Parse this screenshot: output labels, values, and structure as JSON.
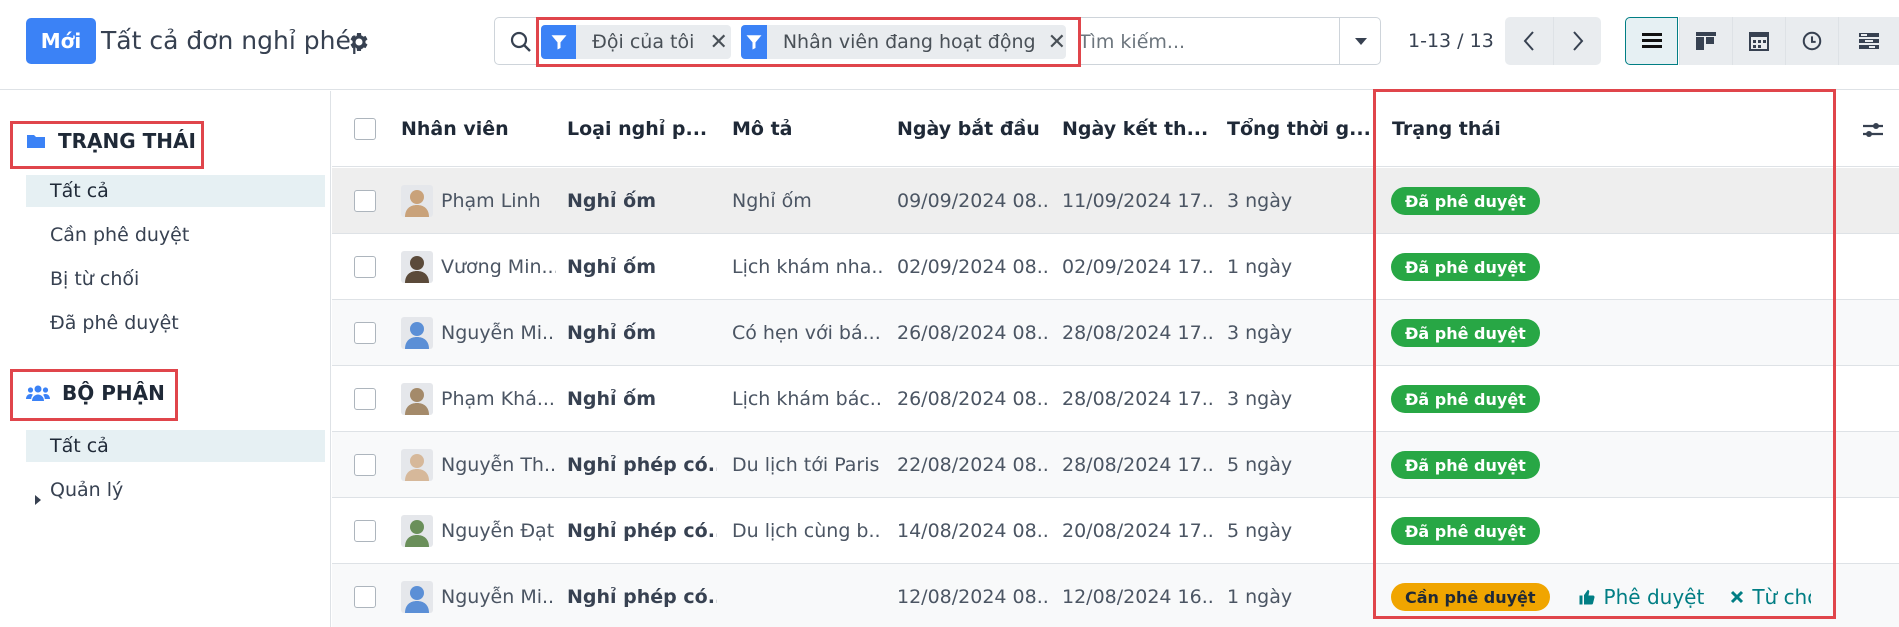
{
  "colors": {
    "primary": "#3b82f6",
    "accent_teal": "#017e84",
    "approved": "#28a745",
    "pending": "#f0a500",
    "highlight_box": "#e0454b"
  },
  "control_panel": {
    "new_button_label": "Mới",
    "title": "Tất cả đơn nghỉ phép",
    "settings_icon": "gear-icon",
    "search": {
      "facets": [
        {
          "label": "Đội của tôi",
          "icon": "filter-icon"
        },
        {
          "label": "Nhân viên đang hoạt động",
          "icon": "filter-icon"
        }
      ],
      "placeholder": "Tìm kiếm..."
    },
    "pager": {
      "value": "1-13 / 13"
    },
    "views": [
      "list-view-icon",
      "kanban-view-icon",
      "calendar-view-icon",
      "activity-view-icon",
      "gantt-view-icon"
    ],
    "active_view": "list"
  },
  "sidebar": {
    "sections": [
      {
        "title": "TRẠNG THÁI",
        "icon": "folder-icon",
        "items": [
          "Tất cả",
          "Cần phê duyệt",
          "Bị từ chối",
          "Đã phê duyệt"
        ],
        "active": 0
      },
      {
        "title": "BỘ PHẬN",
        "icon": "users-icon",
        "items": [
          "Tất cả",
          "Quản lý"
        ],
        "active": 0,
        "expandable_item": 1
      }
    ]
  },
  "table": {
    "columns": [
      "Nhân viên",
      "Loại nghỉ p...",
      "Mô tả",
      "Ngày bắt đầu",
      "Ngày kết th...",
      "Tổng thời g...",
      "Trạng thái"
    ],
    "rows": [
      {
        "employee": "Phạm Linh",
        "type": "Nghỉ ốm",
        "description": "Nghỉ ốm",
        "start": "09/09/2024 08...",
        "end": "11/09/2024 17...",
        "duration": "3 ngày",
        "status": "Đã phê duyệt",
        "status_kind": "approved"
      },
      {
        "employee": "Vương Min...",
        "type": "Nghỉ ốm",
        "description": "Lịch khám nha...",
        "start": "02/09/2024 08...",
        "end": "02/09/2024 17...",
        "duration": "1 ngày",
        "status": "Đã phê duyệt",
        "status_kind": "approved"
      },
      {
        "employee": "Nguyễn Mi...",
        "type": "Nghỉ ốm",
        "description": "Có hẹn với bá...",
        "start": "26/08/2024 08...",
        "end": "28/08/2024 17...",
        "duration": "3 ngày",
        "status": "Đã phê duyệt",
        "status_kind": "approved"
      },
      {
        "employee": "Phạm Khá...",
        "type": "Nghỉ ốm",
        "description": "Lịch khám bác...",
        "start": "26/08/2024 08...",
        "end": "28/08/2024 17...",
        "duration": "3 ngày",
        "status": "Đã phê duyệt",
        "status_kind": "approved"
      },
      {
        "employee": "Nguyễn Th...",
        "type": "Nghỉ phép có...",
        "description": "Du lịch tới Paris",
        "start": "22/08/2024 08...",
        "end": "28/08/2024 17...",
        "duration": "5 ngày",
        "status": "Đã phê duyệt",
        "status_kind": "approved"
      },
      {
        "employee": "Nguyễn Đạt",
        "type": "Nghỉ phép có...",
        "description": "Du lịch cùng b...",
        "start": "14/08/2024 08...",
        "end": "20/08/2024 17...",
        "duration": "5 ngày",
        "status": "Đã phê duyệt",
        "status_kind": "approved"
      },
      {
        "employee": "Nguyễn Mi...",
        "type": "Nghỉ phép có...",
        "description": "",
        "start": "12/08/2024 08...",
        "end": "12/08/2024 16...",
        "duration": "1 ngày",
        "status": "Cần phê duyệt",
        "status_kind": "pending",
        "approve_label": "Phê duyệt",
        "refuse_label": "Từ chối"
      }
    ]
  }
}
